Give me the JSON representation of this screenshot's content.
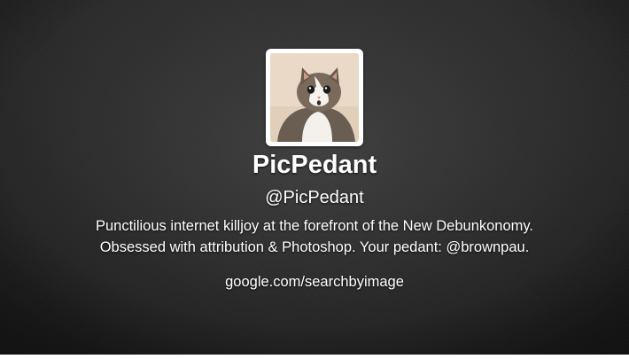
{
  "profile": {
    "avatar_icon": "cat-avatar-icon",
    "name": "PicPedant",
    "handle": "@PicPedant",
    "bio_line_1": "Punctilious internet killjoy at the forefront of the New Debunkonomy.",
    "bio_line_2_prefix": "Obsessed with attribution & Photoshop. Your pedant: ",
    "bio_mention": "@brownpau.",
    "url": "google.com/searchbyimage"
  },
  "colors": {
    "background": "#222222",
    "text": "#ffffff",
    "avatar_border": "#ffffff"
  }
}
